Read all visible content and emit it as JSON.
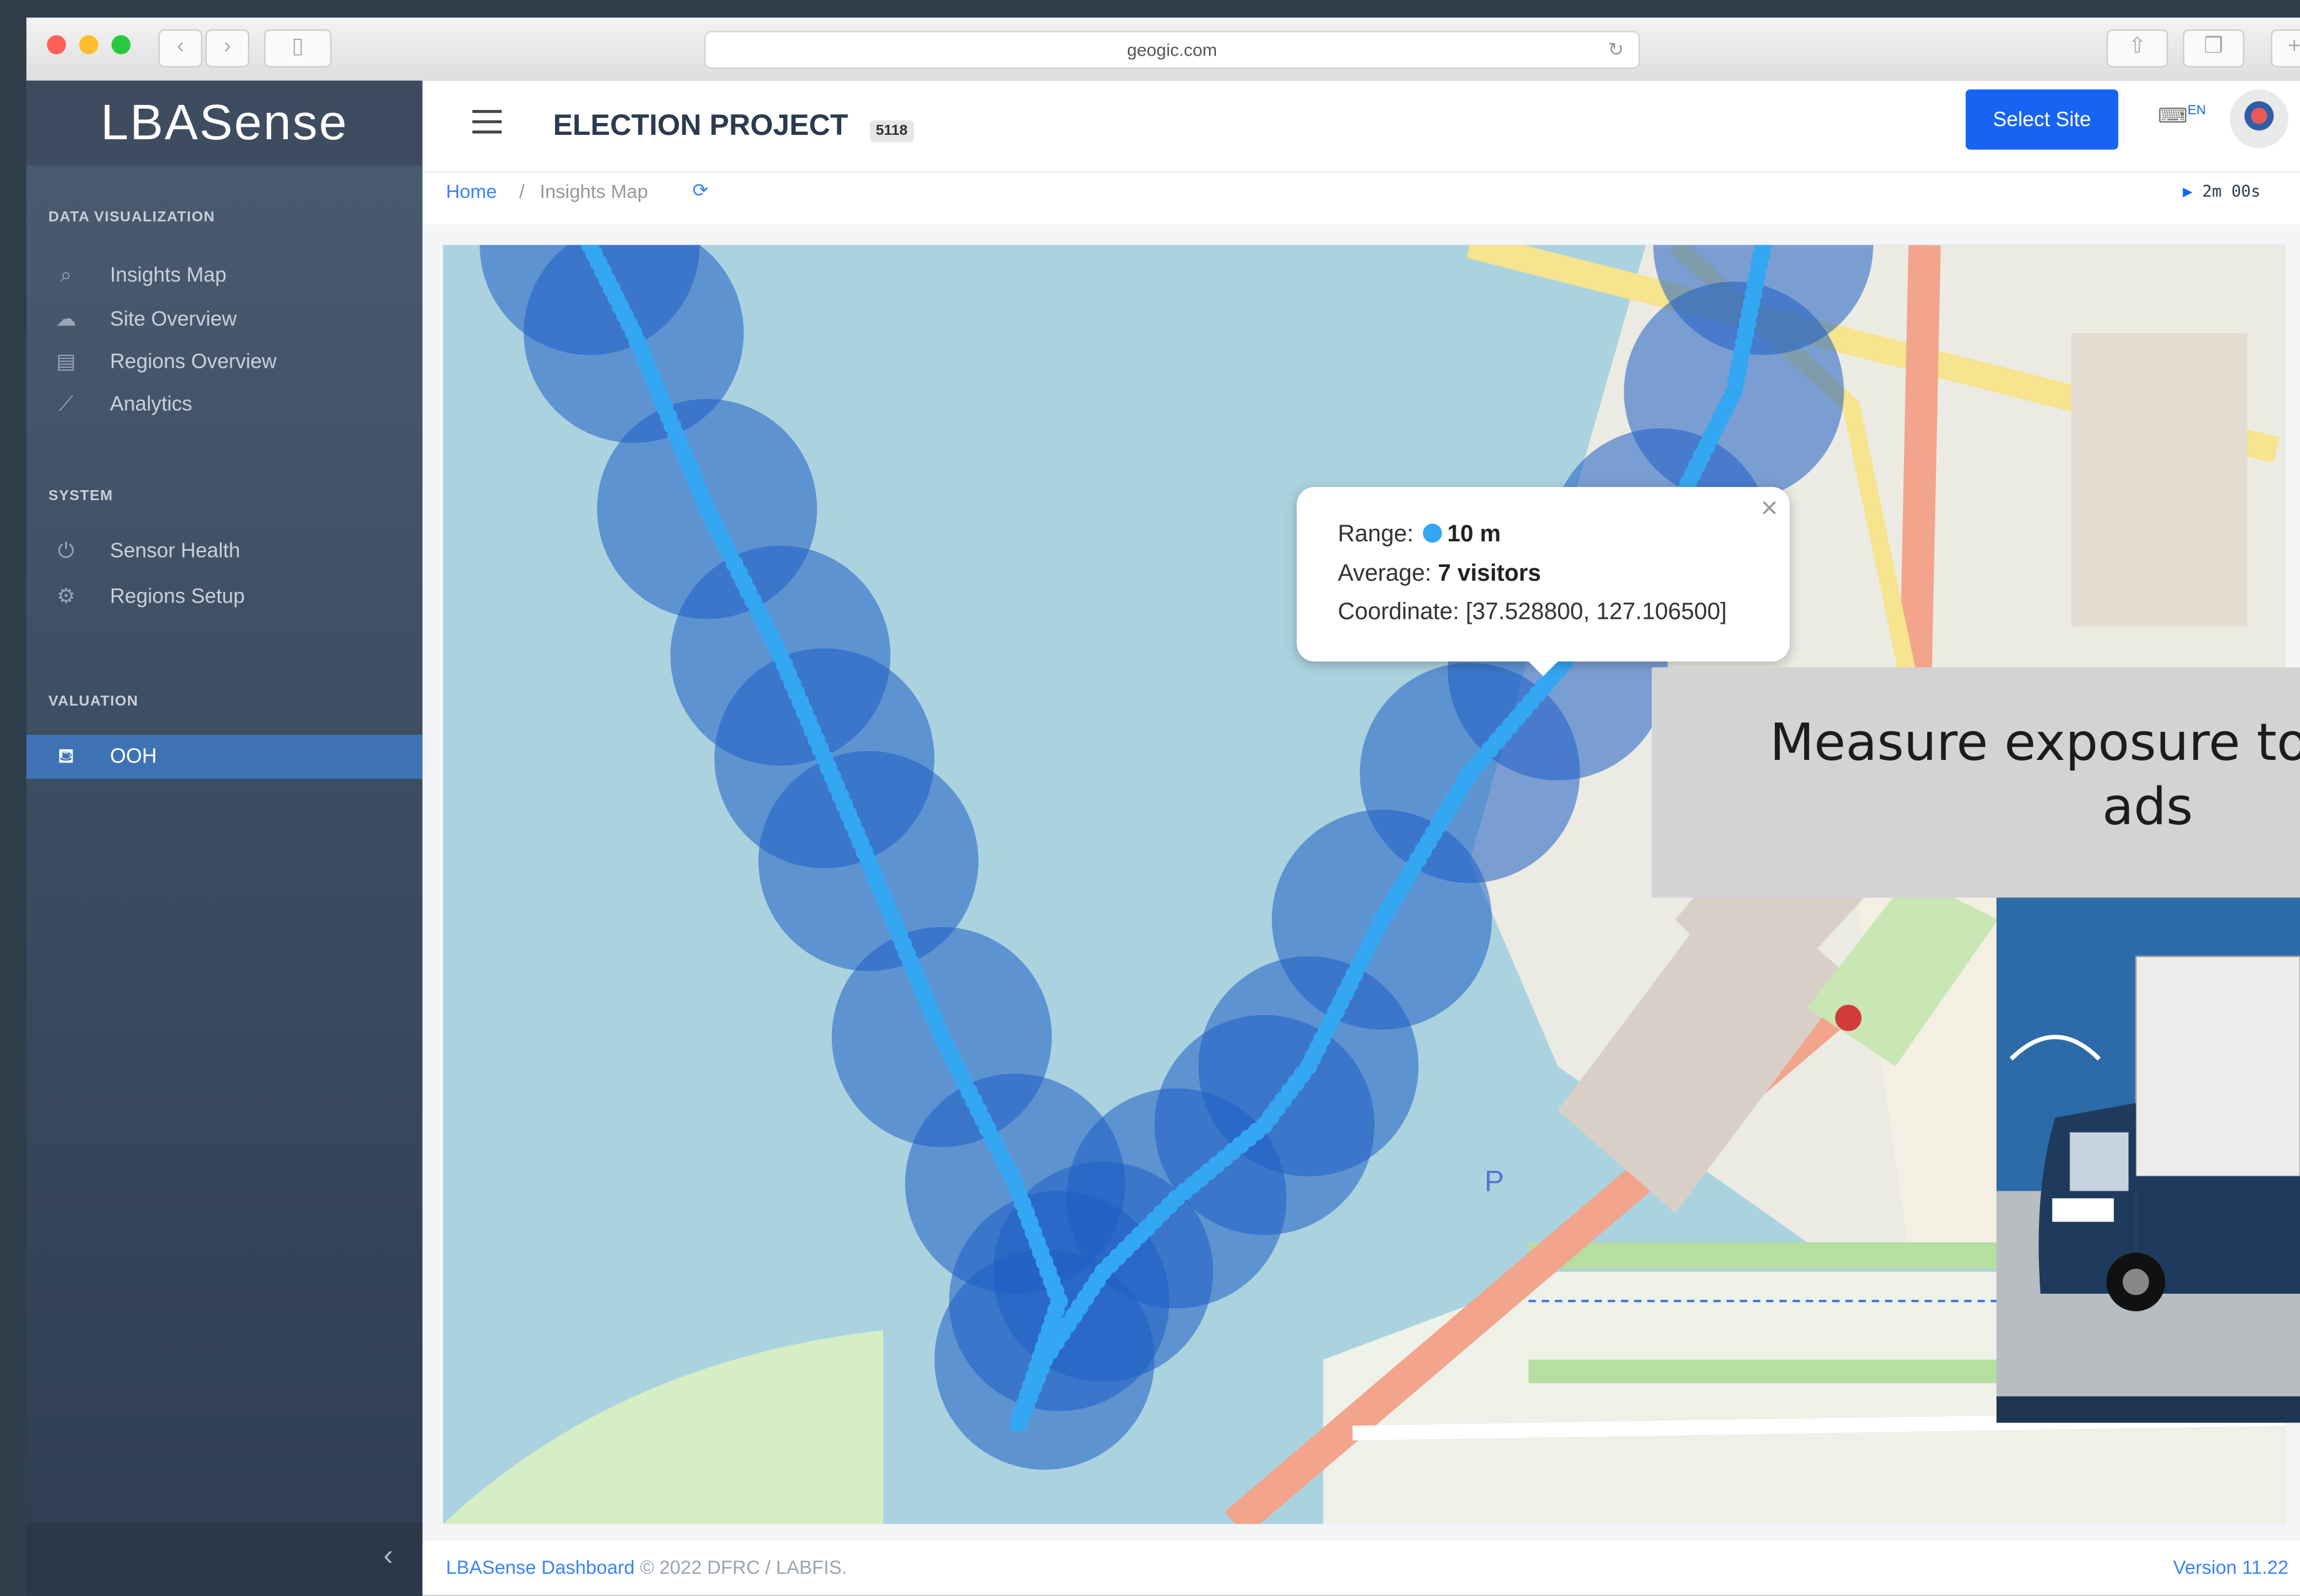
{
  "browser": {
    "url": "geogic.com"
  },
  "app": {
    "logo_text": "LBASense"
  },
  "header": {
    "title": "ELECTION PROJECT",
    "badge": "5118",
    "select_site_label": "Select Site",
    "language": "EN",
    "timer": "2m 00s"
  },
  "breadcrumb": [
    "Home",
    "Insights Map"
  ],
  "breadcrumb_separator": "/",
  "sidebar": {
    "sections": [
      {
        "title": "DATA VISUALIZATION",
        "items": [
          {
            "label": "Insights Map",
            "icon": "map-icon"
          },
          {
            "label": "Site Overview",
            "icon": "cloud-icon"
          },
          {
            "label": "Regions Overview",
            "icon": "table-icon"
          },
          {
            "label": "Analytics",
            "icon": "line-chart-icon"
          }
        ]
      },
      {
        "title": "SYSTEM",
        "items": [
          {
            "label": "Sensor Health",
            "icon": "power-icon"
          },
          {
            "label": "Regions Setup",
            "icon": "gear-icon"
          }
        ]
      },
      {
        "title": "VALUATION",
        "items": [
          {
            "label": "OOH",
            "icon": "billboard-icon",
            "active": true
          }
        ]
      }
    ]
  },
  "popup": {
    "range_label": "Range:",
    "range_value": "10 m",
    "average_label": "Average:",
    "average_value": "7 visitors",
    "coordinate_label": "Coordinate:",
    "coordinate_value": "[37.528800, 127.106500]"
  },
  "overlay": {
    "caption": "Measure exposure to political ads"
  },
  "footer": {
    "link_text": "LBASense Dashboard",
    "copyright": "© 2022 DFRC / LABFIS.",
    "version": "Version 11.22"
  },
  "colors": {
    "accent": "#1764f4",
    "sidebar_active": "#3e74b6",
    "circle_fill": "#1f5fc4",
    "point_fill": "#34a7f2",
    "water": "#abd3df"
  }
}
